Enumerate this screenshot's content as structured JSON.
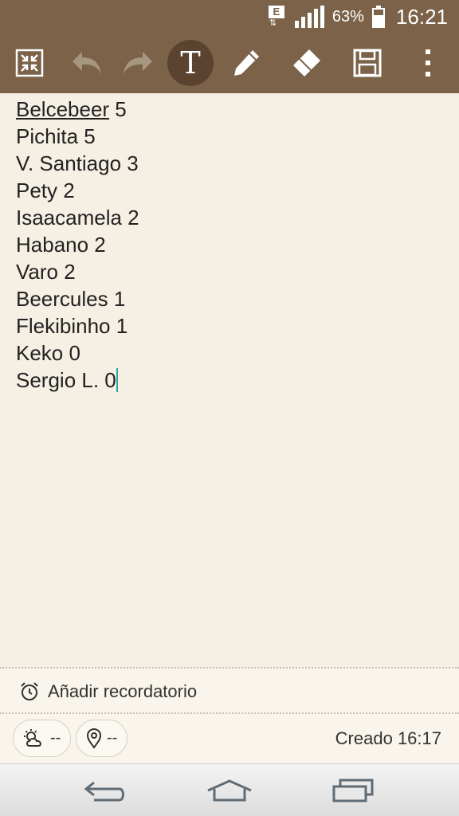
{
  "status_bar": {
    "network_label": "E",
    "battery_percent": "63%",
    "time": "16:21"
  },
  "toolbar": {
    "icons": [
      "collapse-icon",
      "undo-icon",
      "redo-icon",
      "text-format-icon",
      "pen-icon",
      "eraser-icon",
      "save-icon",
      "more-options-icon"
    ],
    "text_tool_label": "T"
  },
  "note": {
    "lines": [
      "Belcebeer",
      "Pichita 5",
      "V. Santiago 3",
      "Pety 2",
      "Isaacamela 2",
      "Habano 2",
      "Varo 2",
      "Beercules 1",
      "Flekibinho 1",
      "Keko 0",
      "Sergio L. 0"
    ],
    "first_line_score": " 5"
  },
  "footer": {
    "reminder_label": "Añadir recordatorio",
    "weather_value": "--",
    "location_value": "--",
    "created_label": "Creado 16:17"
  },
  "colors": {
    "toolbar": "#7b6248",
    "active_tool": "#5a432f",
    "paper": "#f6f0e4",
    "caret": "#2aa7a7"
  }
}
